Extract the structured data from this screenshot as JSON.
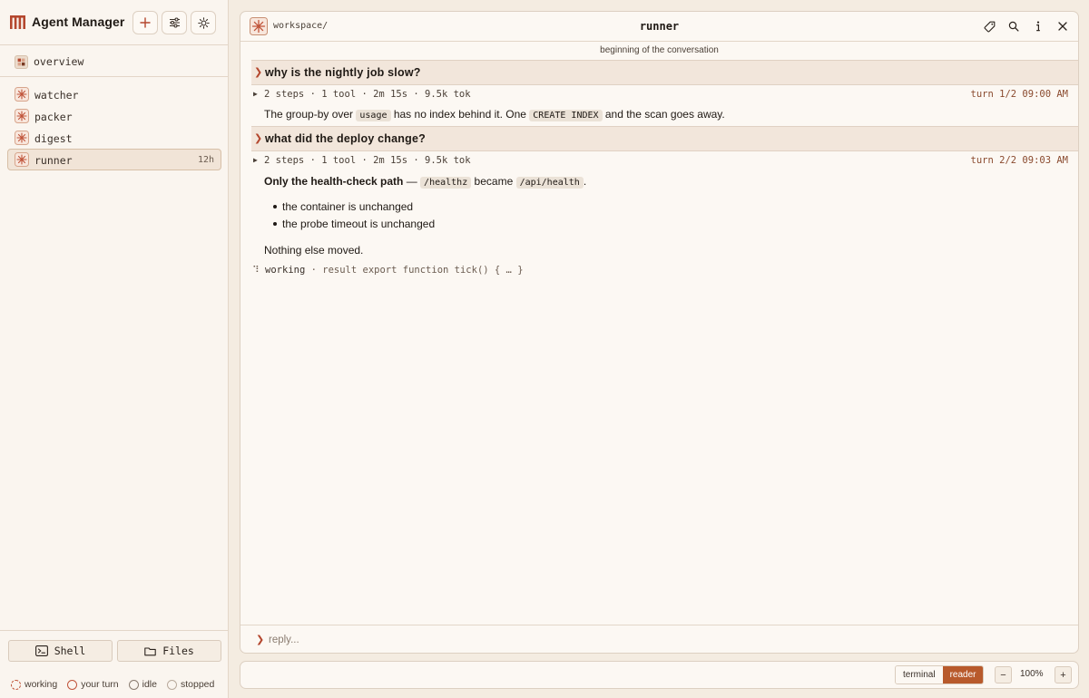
{
  "app": {
    "title": "Agent Manager"
  },
  "sidebar": {
    "overview_label": "overview",
    "agents": [
      {
        "name": "watcher",
        "time": ""
      },
      {
        "name": "packer",
        "time": ""
      },
      {
        "name": "digest",
        "time": ""
      },
      {
        "name": "runner",
        "time": "12h",
        "active": true
      }
    ],
    "shell_label": "Shell",
    "files_label": "Files",
    "status_legend": [
      "working",
      "your turn",
      "idle",
      "stopped"
    ]
  },
  "panel": {
    "path": "workspace/",
    "title": "runner",
    "conversation_start": "beginning of the conversation",
    "turns": [
      {
        "question": "why is the nightly job slow?",
        "meta": "2 steps · 1 tool · 2m 15s · 9.5k tok",
        "turn": "turn 1/2 09:00 AM",
        "answer": {
          "t1": "The group-by over ",
          "c1": "usage",
          "t2": " has no index behind it. One ",
          "c2": "CREATE INDEX",
          "t3": " and the scan goes away."
        }
      },
      {
        "question": "what did the deploy change?",
        "meta": "2 steps · 1 tool · 2m 15s · 9.5k tok",
        "turn": "turn 2/2 09:03 AM",
        "answer": {
          "bold": "Only the health-check path",
          "dash": " — ",
          "c1": "/healthz",
          "t2": " became ",
          "c2": "/api/health",
          "t3": ".",
          "bullets": [
            "the container is unchanged",
            "the probe timeout is unchanged"
          ],
          "closing": "Nothing else moved."
        }
      }
    ],
    "working": {
      "label": "working",
      "detail": " · result export function tick() { … }"
    },
    "reply_placeholder": "reply..."
  },
  "bottombar": {
    "terminal_label": "terminal",
    "reader_label": "reader",
    "zoom_minus": "−",
    "zoom": "100%",
    "zoom_plus": "+"
  },
  "colors": {
    "accent": "#b85a2c",
    "chevron": "#b4472e",
    "question_bg": "#f2e6db"
  }
}
